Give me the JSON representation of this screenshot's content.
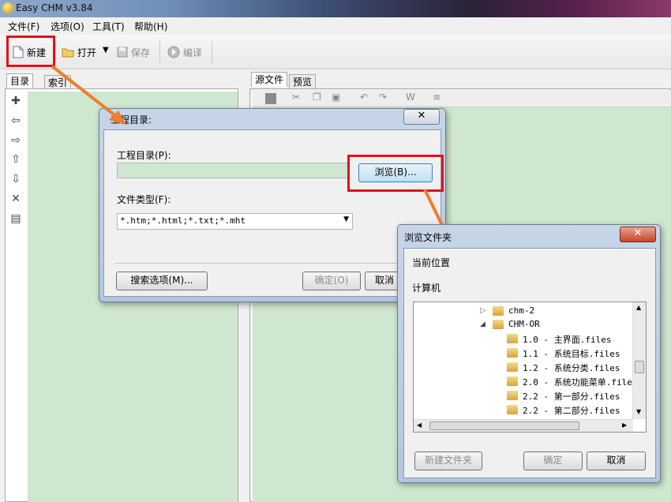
{
  "app": {
    "title": "Easy CHM v3.84"
  },
  "menu": [
    "文件(F)",
    "选项(O)",
    "工具(T)",
    "帮助(H)"
  ],
  "toolbar": {
    "new": "新建",
    "open": "打开",
    "save": "保存",
    "compile": "编译"
  },
  "left_tabs": [
    "目录",
    "索引"
  ],
  "right_tabs": [
    "源文件",
    "预览"
  ],
  "dialog1": {
    "title": "工程目录:",
    "project_dir_label": "工程目录(P):",
    "browse": "浏览(B)...",
    "file_type_label": "文件类型(F):",
    "file_type_value": "*.htm;*.html;*.txt;*.mht",
    "search_options": "搜索选项(M)...",
    "ok": "确定(O)",
    "cancel": "取消"
  },
  "dialog2": {
    "title": "浏览文件夹",
    "current_location": "当前位置",
    "computer": "计算机",
    "tree": [
      {
        "label": "chm-2",
        "level": 0,
        "expander": "▷"
      },
      {
        "label": "CHM-OR",
        "level": 0,
        "expander": "◢"
      },
      {
        "label": "1.0 - 主界面.files",
        "level": 1
      },
      {
        "label": "1.1 - 系统目标.files",
        "level": 1
      },
      {
        "label": "1.2 - 系统分类.files",
        "level": 1
      },
      {
        "label": "2.0 - 系统功能菜单.file",
        "level": 1
      },
      {
        "label": "2.2 - 第一部分.files",
        "level": 1
      },
      {
        "label": "2.2 - 第二部分.files",
        "level": 1
      }
    ],
    "new_folder": "新建文件夹",
    "ok": "确定",
    "cancel": "取消"
  }
}
